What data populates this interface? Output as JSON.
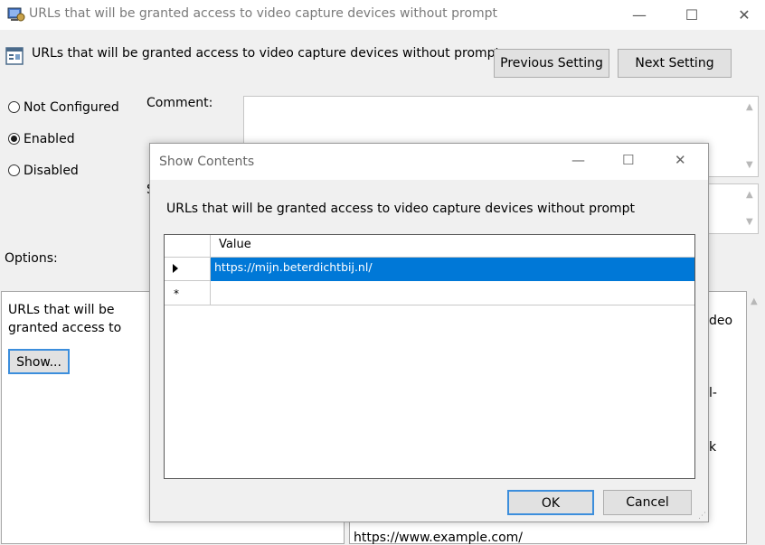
{
  "window": {
    "title": "URLs that will be granted access to video capture devices without prompt",
    "minimize_icon": "minimize-icon",
    "maximize_icon": "maximize-icon",
    "close_icon": "close-icon"
  },
  "header": {
    "title": "URLs that will be granted access to video capture devices without prompt",
    "prev_label": "Previous Setting",
    "next_label": "Next Setting"
  },
  "state": {
    "options": [
      {
        "label": "Not Configured",
        "selected": false
      },
      {
        "label": "Enabled",
        "selected": true
      },
      {
        "label": "Disabled",
        "selected": false
      }
    ]
  },
  "comment": {
    "label": "Comment:",
    "value": ""
  },
  "supported_label_fragment": "S",
  "options": {
    "label": "Options:",
    "text": "URLs that will be granted access to video capture devices without prompt",
    "show_label": "Show..."
  },
  "help": {
    "fragments": [
      "deo",
      "l-",
      "k"
    ],
    "url": "https://www.example.com/"
  },
  "dialog": {
    "title": "Show Contents",
    "label": "URLs that will be granted access to video capture devices without prompt",
    "column_header": "Value",
    "rows": [
      "https://mijn.beterdichtbij.nl/"
    ],
    "new_row_marker": "*",
    "ok_label": "OK",
    "cancel_label": "Cancel"
  },
  "colors": {
    "selection": "#0078d7",
    "focus_border": "#3c8edc"
  }
}
